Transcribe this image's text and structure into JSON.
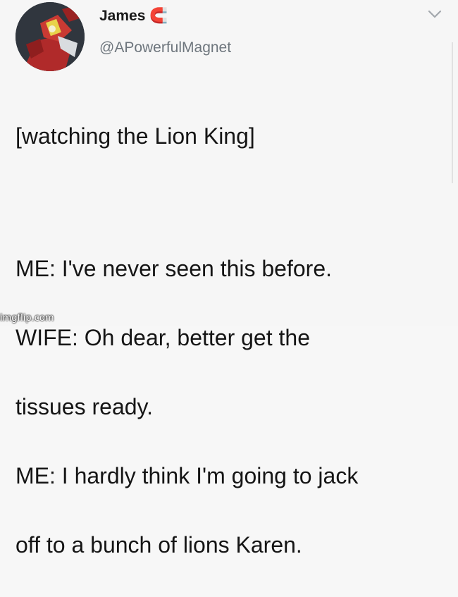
{
  "tweet": {
    "display_name": "James 🧲",
    "handle": "@APowerfulMagnet",
    "heading_line": "[watching the Lion King]",
    "dialogue": [
      "ME: I've never seen this before.",
      "WIFE: Oh dear, better get the",
      "tissues ready.",
      "ME: I hardly think I'm going to jack",
      "off to a bunch of lions Karen."
    ]
  },
  "watermark": "imgflip.com",
  "icons": {
    "avatar": "magnet-robot-avatar",
    "menu": "chevron-down-icon"
  },
  "colors": {
    "background": "#f6f6f6",
    "text": "#151515",
    "handle": "#6e767d"
  }
}
